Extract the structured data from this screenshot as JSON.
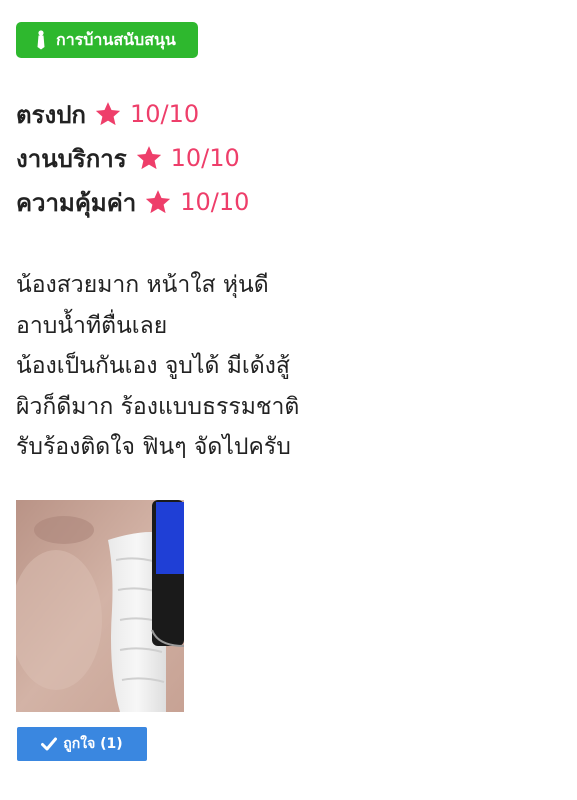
{
  "badge": {
    "label": "การบ้านสนับสนุน",
    "icon": "tie-icon",
    "color": "#2eb82e"
  },
  "ratings": [
    {
      "label": "ตรงปก",
      "score": "10/10",
      "icon": "star-icon"
    },
    {
      "label": "งานบริการ",
      "score": "10/10",
      "icon": "star-icon"
    },
    {
      "label": "ความคุ้มค่า",
      "score": "10/10",
      "icon": "star-icon"
    }
  ],
  "accent_color": "#ee3e6a",
  "review": {
    "lines": [
      "น้องสวยมาก หน้าใส หุ่นดี",
      "อาบน้ำทีตื่นเลย",
      "น้องเป็นกันเอง จูบได้ มีเด้งสู้",
      "ผิวก็ดีมาก ร้องแบบธรรมชาติ",
      "รับร้องติดใจ ฟินๆ จัดไปครับ"
    ]
  },
  "like_button": {
    "label": "ถูกใจ (1)",
    "icon": "check-icon",
    "color": "#3a87e0"
  }
}
